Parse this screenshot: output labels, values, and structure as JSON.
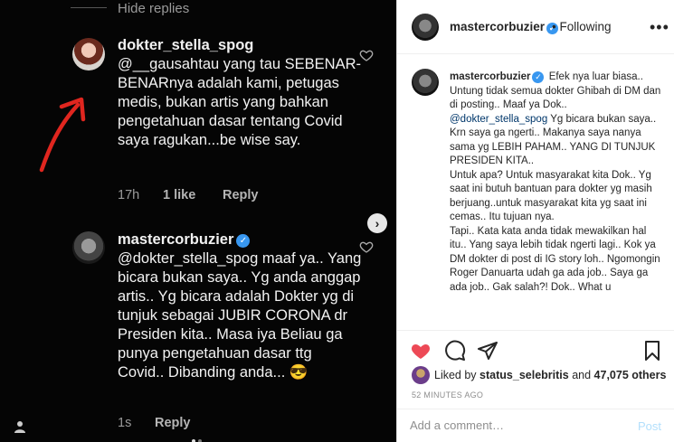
{
  "left": {
    "hide_replies": "Hide replies",
    "comment1": {
      "username": "dokter_stella_spog",
      "mention": "@__gausahtau",
      "text_after_mention": " yang tau SEBENAR-BENARnya adalah kami, petugas medis, bukan artis yang bahkan pengetahuan dasar tentang Covid saya ragukan...be wise say.",
      "time": "17h",
      "likes": "1 like",
      "reply": "Reply"
    },
    "comment2": {
      "username": "mastercorbuzier",
      "mention": "@dokter_stella_spog",
      "text_after_mention": " maaf ya..  Yang bicara bukan saya.. Yg anda anggap artis.. Yg bicara adalah Dokter yg di tunjuk sebagai JUBIR CORONA dr Presiden kita.. Masa iya Beliau ga punya pengetahuan dasar ttg Covid.. Dibanding anda...",
      "emoji": "😎",
      "time": "1s",
      "reply": "Reply"
    },
    "accent_red": "#e0261f"
  },
  "right": {
    "header": {
      "username": "mastercorbuzier",
      "separator": "•",
      "follow_status": "Following",
      "more": "•••"
    },
    "caption": {
      "username": "mastercorbuzier",
      "part1": "Efek nya luar biasa.. Untung tidak semua dokter Ghibah di DM dan di posting.. Maaf ya Dok.. ",
      "mention": "@dokter_stella_spog",
      "part2": " Yg bicara bukan saya.. Krn saya ga ngerti.. Makanya saya nanya sama yg LEBIH PAHAM.. YANG DI TUNJUK PRESIDEN KITA..\nUntuk apa? Untuk masyarakat kita Dok.. Yg saat ini butuh bantuan para dokter yg masih berjuang..untuk masyarakat kita yg saat ini cemas.. Itu tujuan nya.\nTapi.. Kata kata anda tidak mewakilkan hal itu.. Yang saya lebih tidak ngerti lagi.. Kok ya DM dokter di post di IG story loh.. Ngomongin Roger Danuarta udah ga ada job.. Saya ga ada job.. Gak salah?! Dok.. What u"
    },
    "likes": {
      "prefix": "Liked by",
      "user": "status_selebritis",
      "middle": "and",
      "count": "47,075 others"
    },
    "time_ago": "52 MINUTES AGO",
    "comment_placeholder": "Add a comment…",
    "post_label": "Post",
    "like_color": "#ed4956",
    "link_color": "#00376b"
  }
}
